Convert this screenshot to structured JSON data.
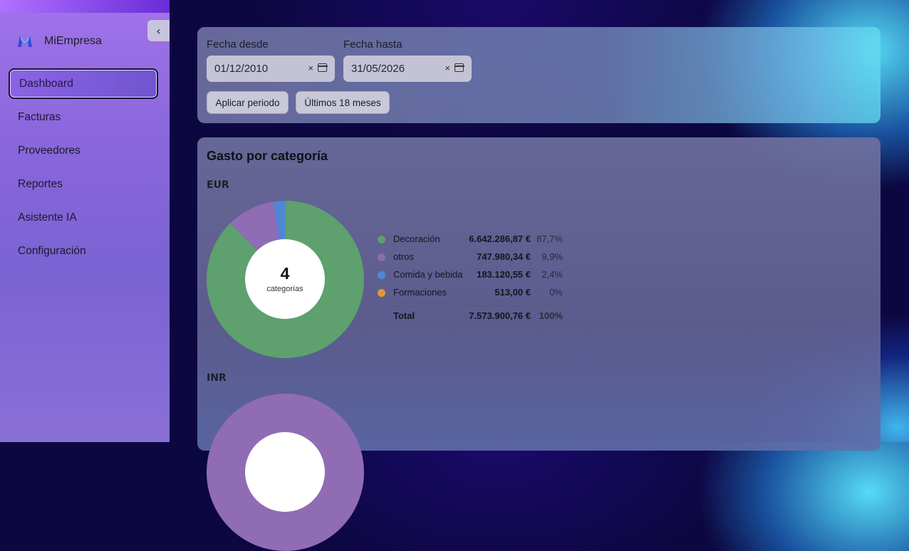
{
  "app": {
    "name": "MiEmpresa"
  },
  "sidebar": {
    "collapse_label": "‹",
    "items": [
      {
        "label": "Dashboard",
        "active": true
      },
      {
        "label": "Facturas"
      },
      {
        "label": "Proveedores"
      },
      {
        "label": "Reportes"
      },
      {
        "label": "Asistente IA"
      },
      {
        "label": "Configuración"
      }
    ]
  },
  "filters": {
    "from_label": "Fecha desde",
    "from_value": "01/12/2010",
    "to_label": "Fecha hasta",
    "to_value": "31/05/2026",
    "clear_glyph": "×",
    "apply_label": "Aplicar periodo",
    "last18_label": "Últimos 18 meses"
  },
  "spend": {
    "title": "Gasto por categoría",
    "currencies": [
      "EUR",
      "INR"
    ],
    "eur": {
      "count": "4",
      "count_label": "categorías",
      "rows": [
        {
          "name": "Decoración",
          "value": "6.642.286,87 €",
          "pct": "87,7%",
          "color": "#5ea06e"
        },
        {
          "name": "otros",
          "value": "747.980,34 €",
          "pct": "9,9%",
          "color": "#8f6cb4"
        },
        {
          "name": "Comida y bebida",
          "value": "183.120,55 €",
          "pct": "2,4%",
          "color": "#4f86d6"
        },
        {
          "name": "Formaciones",
          "value": "513,00 €",
          "pct": "0%",
          "color": "#e0983a"
        }
      ],
      "total_label": "Total",
      "total_value": "7.573.900,76 €",
      "total_pct": "100%"
    }
  },
  "chart_data": {
    "type": "pie",
    "title": "EUR",
    "categories": [
      "Decoración",
      "otros",
      "Comida y bebida",
      "Formaciones"
    ],
    "values": [
      6642286.87,
      747980.34,
      183120.55,
      513.0
    ],
    "percentages": [
      87.7,
      9.9,
      2.4,
      0
    ],
    "colors": [
      "#5ea06e",
      "#8f6cb4",
      "#4f86d6",
      "#e0983a"
    ]
  }
}
